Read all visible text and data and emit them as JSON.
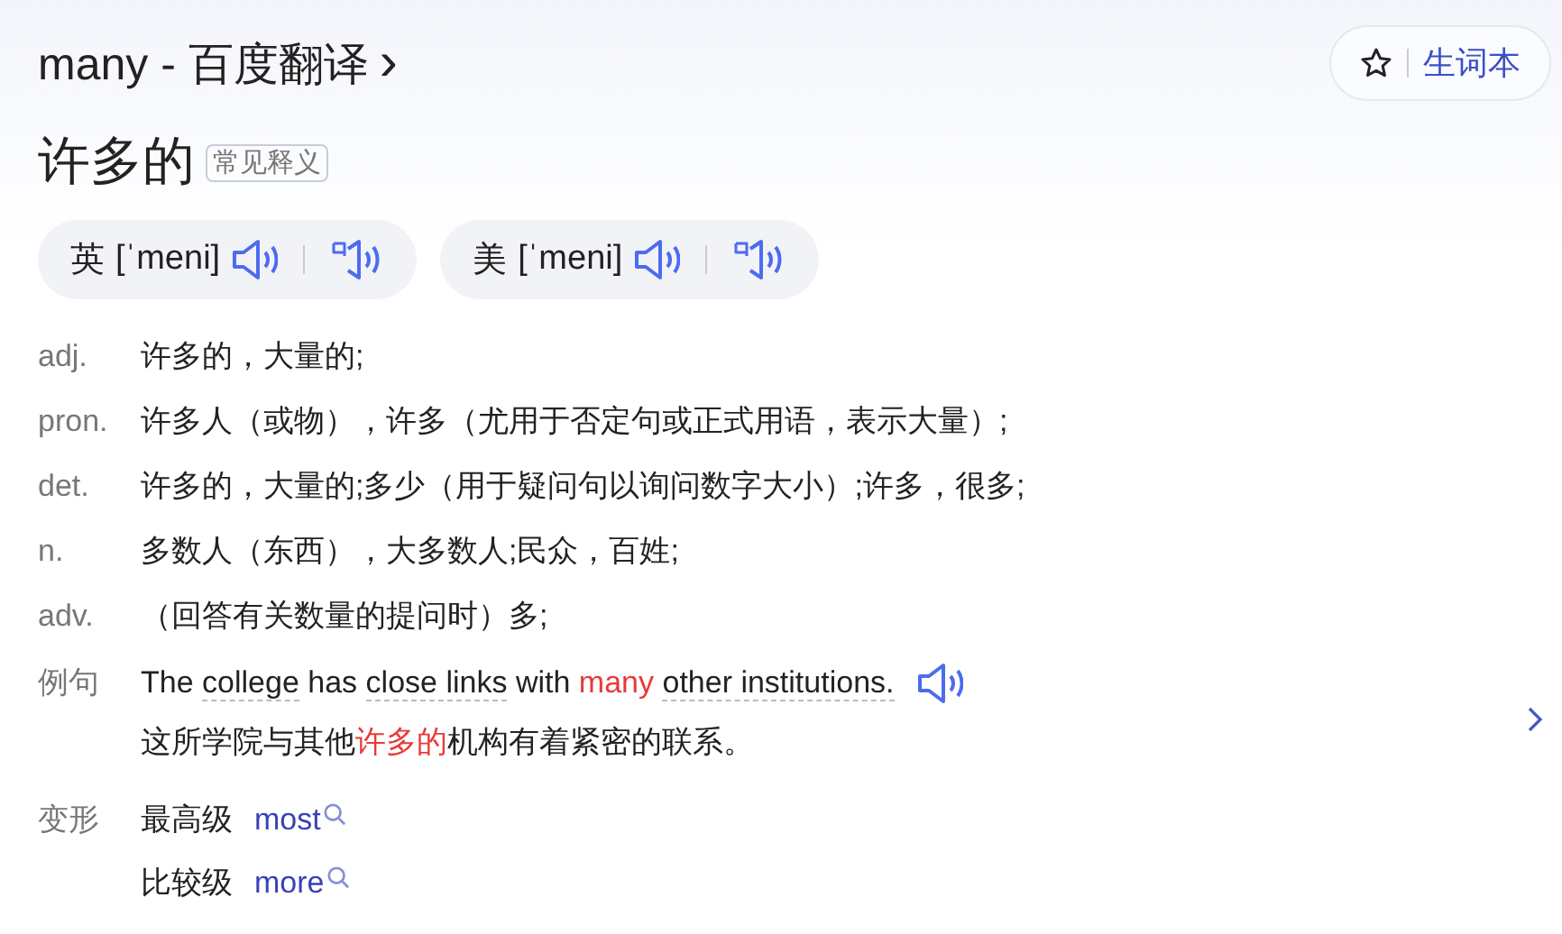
{
  "title": {
    "text": "many - 百度翻译",
    "chevron": "›"
  },
  "wordbook_button": {
    "label": "生词本"
  },
  "headword": {
    "text": "许多的",
    "tag": "常见释义"
  },
  "pronunciations": [
    {
      "region": "英",
      "phonetic": "[ˈmeni]"
    },
    {
      "region": "美",
      "phonetic": "[ˈmeni]"
    }
  ],
  "definitions": [
    {
      "pos": "adj.",
      "text": "许多的，大量的;"
    },
    {
      "pos": "pron.",
      "text": "许多人（或物），许多（尤用于否定句或正式用语，表示大量）;"
    },
    {
      "pos": "det.",
      "text": "许多的，大量的;多少（用于疑问句以询问数字大小）;许多，很多;"
    },
    {
      "pos": "n.",
      "text": "多数人（东西），大多数人;民众，百姓;"
    },
    {
      "pos": "adv.",
      "text": "（回答有关数量的提问时）多;"
    }
  ],
  "example": {
    "label": "例句",
    "sentence": [
      {
        "kind": "plain",
        "text": "The"
      },
      {
        "kind": "link",
        "text": "college"
      },
      {
        "kind": "plain",
        "text": "has"
      },
      {
        "kind": "link",
        "text": "close links"
      },
      {
        "kind": "plain",
        "text": "with"
      },
      {
        "kind": "highlight",
        "text": "many"
      },
      {
        "kind": "link",
        "text": "other institutions."
      }
    ],
    "translation": [
      {
        "kind": "plain",
        "text": "这所学院与其他"
      },
      {
        "kind": "highlight",
        "text": "许多的"
      },
      {
        "kind": "plain",
        "text": "机构有着紧密的联系。"
      }
    ]
  },
  "forms": {
    "label": "变形",
    "items": [
      {
        "name": "最高级",
        "word": "most"
      },
      {
        "name": "比较级",
        "word": "more"
      }
    ]
  }
}
